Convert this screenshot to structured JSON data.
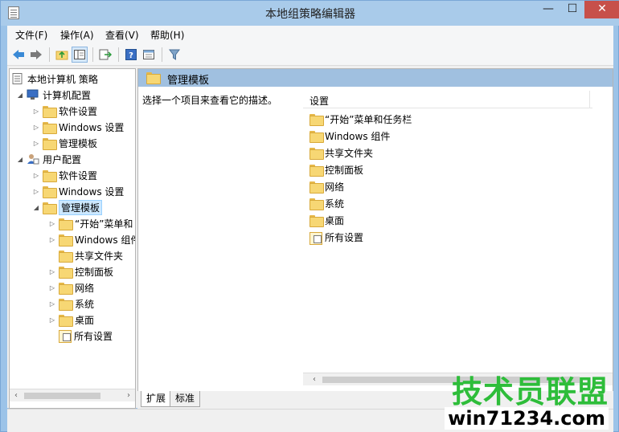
{
  "window": {
    "title": "本地组策略编辑器"
  },
  "menu": [
    {
      "label": "文件(F)"
    },
    {
      "label": "操作(A)"
    },
    {
      "label": "查看(V)"
    },
    {
      "label": "帮助(H)"
    }
  ],
  "tree": {
    "root": "本地计算机 策略",
    "computer_config": "计算机配置",
    "computer_children": [
      "软件设置",
      "Windows 设置",
      "管理模板"
    ],
    "user_config": "用户配置",
    "user_children": [
      "软件设置",
      "Windows 设置",
      "管理模板"
    ],
    "admin_children": [
      "“开始”菜单和",
      "Windows 组件",
      "共享文件夹",
      "控制面板",
      "网络",
      "系统",
      "桌面",
      "所有设置"
    ]
  },
  "main": {
    "title": "管理模板",
    "description": "选择一个项目来查看它的描述。",
    "column": "设置",
    "items": [
      "“开始”菜单和任务栏",
      "Windows 组件",
      "共享文件夹",
      "控制面板",
      "网络",
      "系统",
      "桌面",
      "所有设置"
    ]
  },
  "tabs": [
    "扩展",
    "标准"
  ],
  "watermark": {
    "line1": "技术员联盟",
    "line2": "win71234.com"
  }
}
